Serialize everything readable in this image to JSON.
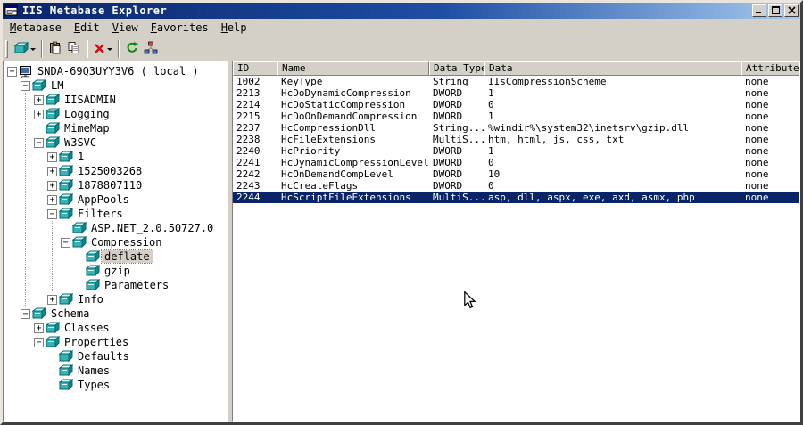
{
  "window": {
    "title": "IIS Metabase Explorer",
    "controls": [
      "minimize",
      "maximize",
      "close"
    ]
  },
  "menu": {
    "items": [
      "Metabase",
      "Edit",
      "View",
      "Favorites",
      "Help"
    ]
  },
  "toolbar": {
    "buttons": [
      {
        "name": "new-key",
        "icon": "new-key-icon",
        "dropdown": true
      },
      {
        "name": "paste",
        "icon": "paste-icon",
        "dropdown": false
      },
      {
        "name": "copy",
        "icon": "copy-icon",
        "dropdown": false
      },
      {
        "name": "delete",
        "icon": "delete-icon",
        "dropdown": true
      },
      {
        "name": "refresh",
        "icon": "refresh-icon",
        "dropdown": false
      },
      {
        "name": "connect",
        "icon": "connect-icon",
        "dropdown": false
      }
    ]
  },
  "tree": {
    "items": [
      {
        "label": "SNDA-69Q3UYY3V6 ( local )",
        "level": 0,
        "toggle": "minus",
        "icon": "computer",
        "selected": false
      },
      {
        "label": "LM",
        "level": 1,
        "toggle": "minus",
        "icon": "key",
        "selected": false
      },
      {
        "label": "IISADMIN",
        "level": 2,
        "toggle": "plus",
        "icon": "key",
        "selected": false
      },
      {
        "label": "Logging",
        "level": 2,
        "toggle": "plus",
        "icon": "key",
        "selected": false
      },
      {
        "label": "MimeMap",
        "level": 2,
        "toggle": "none",
        "icon": "key",
        "selected": false
      },
      {
        "label": "W3SVC",
        "level": 2,
        "toggle": "minus",
        "icon": "key",
        "selected": false
      },
      {
        "label": "1",
        "level": 3,
        "toggle": "plus",
        "icon": "key",
        "selected": false
      },
      {
        "label": "1525003268",
        "level": 3,
        "toggle": "plus",
        "icon": "key",
        "selected": false
      },
      {
        "label": "1878807110",
        "level": 3,
        "toggle": "plus",
        "icon": "key",
        "selected": false
      },
      {
        "label": "AppPools",
        "level": 3,
        "toggle": "plus",
        "icon": "key",
        "selected": false
      },
      {
        "label": "Filters",
        "level": 3,
        "toggle": "minus",
        "icon": "key",
        "selected": false
      },
      {
        "label": "ASP.NET_2.0.50727.0",
        "level": 4,
        "toggle": "none",
        "icon": "key",
        "selected": false
      },
      {
        "label": "Compression",
        "level": 4,
        "toggle": "minus",
        "icon": "key",
        "selected": false
      },
      {
        "label": "deflate",
        "level": 5,
        "toggle": "none",
        "icon": "key",
        "selected": true
      },
      {
        "label": "gzip",
        "level": 5,
        "toggle": "none",
        "icon": "key",
        "selected": false
      },
      {
        "label": "Parameters",
        "level": 5,
        "toggle": "none",
        "icon": "key",
        "selected": false
      },
      {
        "label": "Info",
        "level": 3,
        "toggle": "plus",
        "icon": "key",
        "selected": false
      },
      {
        "label": "Schema",
        "level": 1,
        "toggle": "minus",
        "icon": "key",
        "selected": false
      },
      {
        "label": "Classes",
        "level": 2,
        "toggle": "plus",
        "icon": "key",
        "selected": false
      },
      {
        "label": "Properties",
        "level": 2,
        "toggle": "minus",
        "icon": "key",
        "selected": false
      },
      {
        "label": "Defaults",
        "level": 3,
        "toggle": "none",
        "icon": "key",
        "selected": false
      },
      {
        "label": "Names",
        "level": 3,
        "toggle": "none",
        "icon": "key",
        "selected": false
      },
      {
        "label": "Types",
        "level": 3,
        "toggle": "none",
        "icon": "key",
        "selected": false
      }
    ]
  },
  "table": {
    "columns": [
      "ID",
      "Name",
      "Data Type",
      "Data",
      "Attributes"
    ],
    "selected_row": 10,
    "rows": [
      [
        "1002",
        "KeyType",
        "String",
        "IIsCompressionScheme",
        "none"
      ],
      [
        "2213",
        "HcDoDynamicCompression",
        "DWORD",
        "1",
        "none"
      ],
      [
        "2214",
        "HcDoStaticCompression",
        "DWORD",
        "0",
        "none"
      ],
      [
        "2215",
        "HcDoOnDemandCompression",
        "DWORD",
        "1",
        "none"
      ],
      [
        "2237",
        "HcCompressionDll",
        "String...",
        "%windir%\\system32\\inetsrv\\gzip.dll",
        "none"
      ],
      [
        "2238",
        "HcFileExtensions",
        "MultiS...",
        "htm, html, js, css, txt",
        "none"
      ],
      [
        "2240",
        "HcPriority",
        "DWORD",
        "1",
        "none"
      ],
      [
        "2241",
        "HcDynamicCompressionLevel",
        "DWORD",
        "0",
        "none"
      ],
      [
        "2242",
        "HcOnDemandCompLevel",
        "DWORD",
        "10",
        "none"
      ],
      [
        "2243",
        "HcCreateFlags",
        "DWORD",
        "0",
        "none"
      ],
      [
        "2244",
        "HcScriptFileExtensions",
        "MultiS...",
        "asp, dll, aspx, exe, axd, asmx, php",
        "none"
      ]
    ]
  },
  "colors": {
    "window_face": "#d4d0c8",
    "selection": "#0a246a",
    "titlebar_start": "#0a246a",
    "titlebar_end": "#a6caf0",
    "tree_key_icon": "#35b3b6"
  }
}
